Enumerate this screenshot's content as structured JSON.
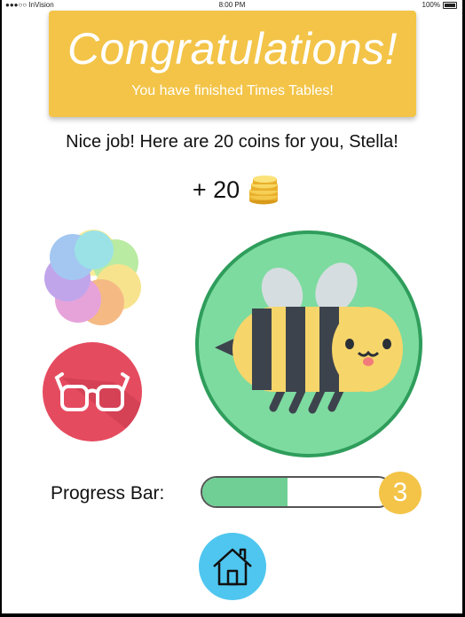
{
  "statusbar": {
    "carrier": "●●●○○ InVision",
    "time": "8:00 PM",
    "battery": "100%"
  },
  "banner": {
    "title": "Congratulations!",
    "subtitle": "You have finished Times Tables!"
  },
  "message": "Nice job! Here are  20 coins for you, Stella!",
  "reward": {
    "text": "+ 20",
    "icon": "coin-stack-icon"
  },
  "buttons": {
    "photos": "photos-icon",
    "glasses": "glasses-icon",
    "home": "home-icon"
  },
  "avatar": {
    "icon": "bee-icon"
  },
  "progress": {
    "label": "Progress Bar:",
    "fraction": 0.45,
    "level": "3"
  },
  "colors": {
    "banner": "#f3c448",
    "avatar_bg": "#7ddba0",
    "avatar_ring": "#2f9d5b",
    "glasses_bg": "#e54b5f",
    "home_bg": "#4fc6ef",
    "progress_fill": "#6fcf95"
  }
}
